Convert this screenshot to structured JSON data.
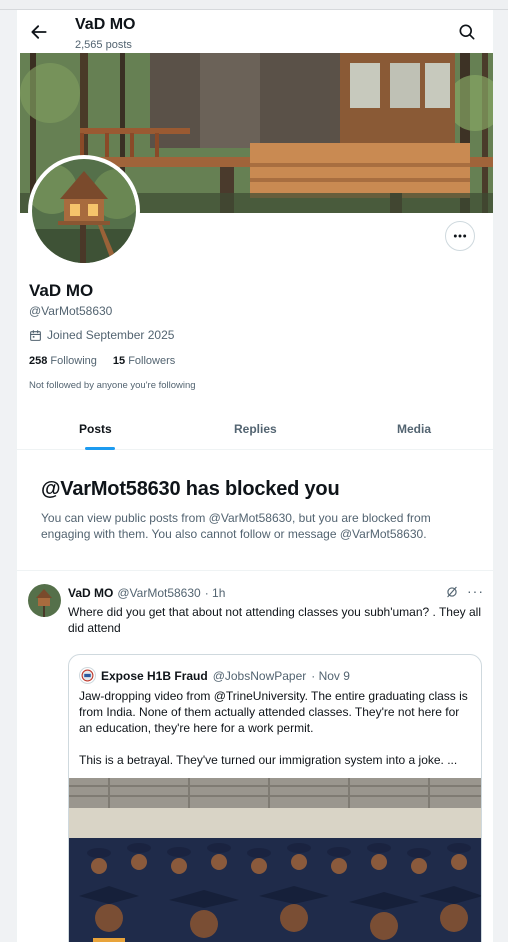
{
  "header": {
    "title": "VaD MO",
    "post_count": "2,565 posts"
  },
  "profile": {
    "name": "VaD MO",
    "handle": "@VarMot58630",
    "joined": "Joined September 2025",
    "following_count": "258",
    "following_label": "Following",
    "followers_count": "15",
    "followers_label": "Followers",
    "not_followed_text": "Not followed by anyone you're following"
  },
  "tabs": [
    {
      "label": "Posts",
      "active": true
    },
    {
      "label": "Replies",
      "active": false
    },
    {
      "label": "Media",
      "active": false
    }
  ],
  "blocked_notice": {
    "title": "@VarMot58630 has blocked you",
    "description": "You can view public posts from @VarMot58630, but you are blocked from engaging with them. You also cannot follow or message @VarMot58630."
  },
  "post": {
    "author_name": "VaD MO",
    "author_handle": "@VarMot58630",
    "time": "· 1h",
    "text": "Where did you get that about not attending classes you subh'uman? . They all did attend",
    "quote": {
      "author_name": "Expose H1B Fraud",
      "author_handle": "@JobsNowPaper",
      "time": "· Nov 9",
      "text": "Jaw-dropping video from @TrineUniversity. The entire graduating class is from India. None of them actually attended classes. They're not here for an education, they're here for a work permit.\n\nThis is a betrayal. They've turned our immigration system into a joke.  ..."
    }
  },
  "icons": {
    "back": "arrow-left-icon",
    "search": "search-icon",
    "more": "more-horizontal-icon",
    "calendar": "calendar-icon",
    "grok": "grok-icon"
  },
  "colors": {
    "accent": "#1d9bf0",
    "text": "#0f1419",
    "secondary": "#536471"
  }
}
